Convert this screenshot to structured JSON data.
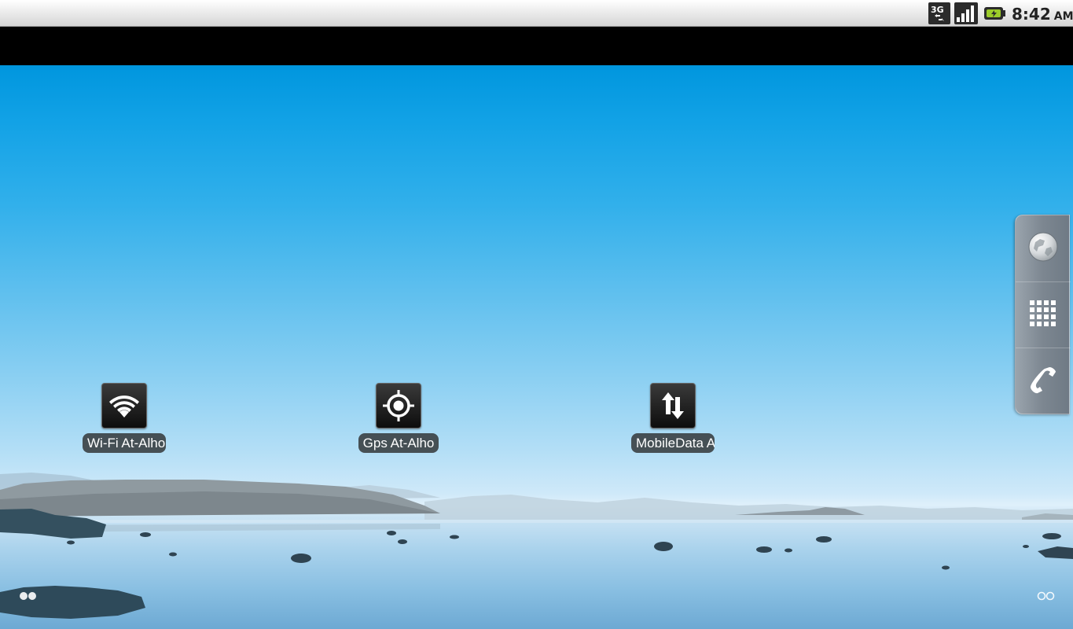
{
  "status_bar": {
    "network_type": "3G",
    "time": "8:42",
    "ampm": "AM",
    "icons": [
      "3g-data-icon",
      "signal-strength-icon",
      "battery-icon"
    ]
  },
  "shortcuts": [
    {
      "label": "Wi-Fi At-Alho",
      "icon": "wifi-icon"
    },
    {
      "label": "Gps At-Alho",
      "icon": "gps-icon"
    },
    {
      "label": "MobileData A",
      "icon": "mobile-data-icon"
    }
  ],
  "dock": {
    "items": [
      "browser-globe-icon",
      "app-drawer-grid-icon",
      "phone-icon"
    ]
  },
  "colors": {
    "sky_top": "#0096de",
    "horizon": "#dff0fb",
    "status_bar_bg": "#e6e6e6",
    "label_bg": "#282828"
  }
}
